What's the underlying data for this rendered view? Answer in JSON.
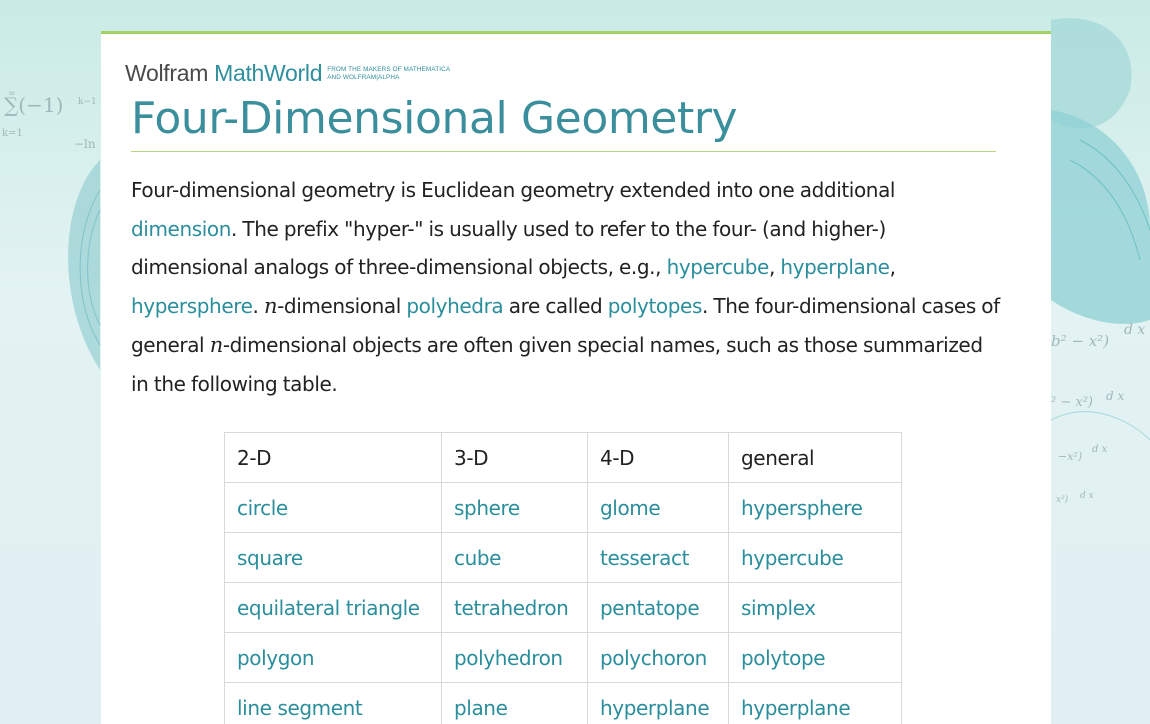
{
  "logo": {
    "wolfram": "Wolfram",
    "mathworld": "MathWorld",
    "tagline_top": "FROM THE MAKERS OF MATHEMATICA",
    "tagline_bottom": "AND WOLFRAM|ALPHA"
  },
  "page": {
    "title": "Four-Dimensional Geometry"
  },
  "intro": {
    "t1": "Four-dimensional geometry is Euclidean geometry extended into one additional ",
    "l_dimension": "dimension",
    "t2": ". The prefix \"hyper-\" is usually used to refer to the four- (and higher-) dimensional analogs of three-dimensional objects, e.g., ",
    "l_hypercube": "hypercube",
    "t3": ", ",
    "l_hyperplane": "hyperplane",
    "t4": ", ",
    "l_hypersphere": "hypersphere",
    "t5": ". ",
    "math_n1": "n",
    "t6": "-dimensional ",
    "l_polyhedra": "polyhedra",
    "t7": " are called ",
    "l_polytopes": "polytopes",
    "t8": ". The four-dimensional cases of general ",
    "math_n2": "n",
    "t9": "-dimensional objects are often given special names, such as those summarized in the following table."
  },
  "table": {
    "headers": [
      "2-D",
      "3-D",
      "4-D",
      "general"
    ],
    "rows": [
      [
        "circle",
        "sphere",
        "glome",
        "hypersphere"
      ],
      [
        "square",
        "cube",
        "tesseract",
        "hypercube"
      ],
      [
        "equilateral triangle",
        "tetrahedron",
        "pentatope",
        "simplex"
      ],
      [
        "polygon",
        "polyhedron",
        "polychoron",
        "polytope"
      ],
      [
        "line segment",
        "plane",
        "hyperplane",
        "hyperplane"
      ]
    ]
  },
  "background": {
    "formula_sum": "∑(−1)",
    "formula_exp": "k−1",
    "formula_top": "∞",
    "formula_idx": "k=1",
    "formula_ln": "−ln",
    "dx": "d x",
    "frac1": "b² − x²)",
    "frac2": "² − x²)",
    "frac3": "−x²)",
    "frac4": "x²)"
  },
  "colors": {
    "accent": "#3b8f9c",
    "link": "#2b8e9c",
    "rule": "#a6d263",
    "background": "#ddeef0"
  }
}
